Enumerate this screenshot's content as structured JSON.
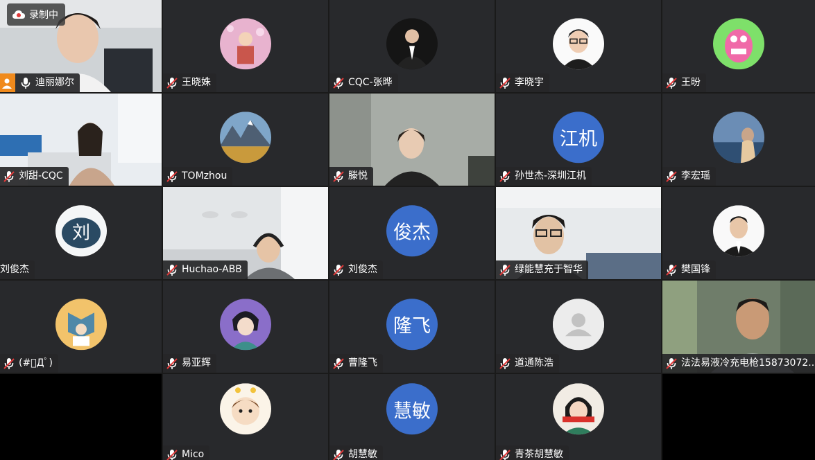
{
  "recording": {
    "label": "录制中"
  },
  "participants": [
    {
      "name": "迪丽娜尔",
      "type": "video-woman-office"
    },
    {
      "name": "王晓姝",
      "type": "photo-child"
    },
    {
      "name": "CQC-张晔",
      "type": "photo-suit"
    },
    {
      "name": "李晓宇",
      "type": "photo-man"
    },
    {
      "name": "王昐",
      "type": "photo-cartoon"
    },
    {
      "name": "刘甜-CQC",
      "type": "video-woman-room"
    },
    {
      "name": "TOMzhou",
      "type": "photo-mountain"
    },
    {
      "name": "滕悦",
      "type": "video-woman-glasses"
    },
    {
      "name": "孙世杰-深圳江机",
      "avatar_text": "江机",
      "type": "text"
    },
    {
      "name": "李宏瑶",
      "type": "photo-sea"
    },
    {
      "name": "刘俊杰",
      "type": "photo-calligraphy",
      "avatar_glyph": "刘"
    },
    {
      "name": "Huchao-ABB",
      "type": "video-man-headset"
    },
    {
      "name": "刘俊杰",
      "avatar_text": "俊杰",
      "type": "text"
    },
    {
      "name": "绿能慧充于智华",
      "type": "video-man-glasses"
    },
    {
      "name": "樊国锋",
      "type": "photo-man2"
    },
    {
      "name": "(#ﾟДﾟ)",
      "type": "photo-books"
    },
    {
      "name": "易亚辉",
      "type": "photo-anime"
    },
    {
      "name": "曹隆飞",
      "avatar_text": "隆飞",
      "type": "text"
    },
    {
      "name": "道通陈浩",
      "type": "default"
    },
    {
      "name": "法法易液冷充电枪15873072...",
      "type": "video-man-blue"
    },
    {
      "name": "",
      "type": "black"
    },
    {
      "name": "Mico",
      "type": "photo-girl"
    },
    {
      "name": "胡慧敏",
      "avatar_text": "慧敏",
      "type": "text"
    },
    {
      "name": "青茶胡慧敏",
      "type": "photo-girl2"
    },
    {
      "name": "",
      "type": "black"
    }
  ],
  "colors": {
    "tile_bg": "#28292c",
    "avatar_blue": "#3b6ecb",
    "mute_red": "#e03a3a",
    "badge_orange": "#f08a1c"
  }
}
